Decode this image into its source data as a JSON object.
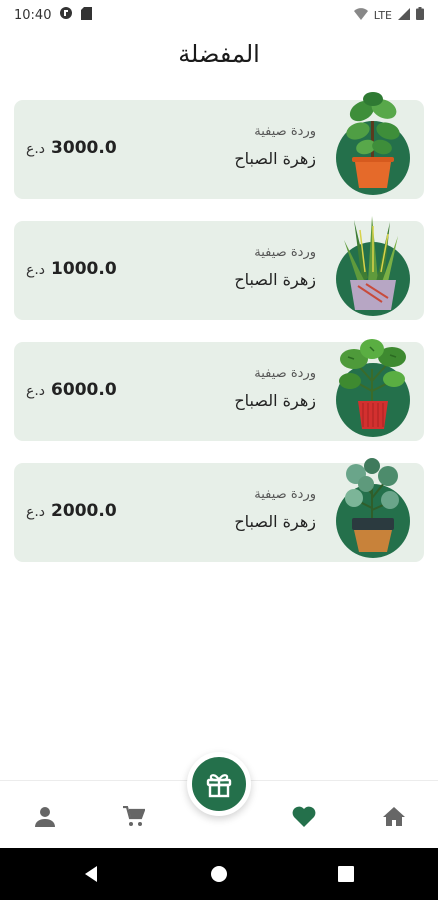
{
  "status_bar": {
    "time": "10:40",
    "network": "LTE"
  },
  "page_title": "المفضلة",
  "items": [
    {
      "subtitle": "وردة صيفية",
      "title": "زهرة الصباح",
      "price": "3000.0",
      "currency": "د.ع",
      "plant_icon": "fiddle-leaf-fig"
    },
    {
      "subtitle": "وردة صيفية",
      "title": "زهرة الصباح",
      "price": "1000.0",
      "currency": "د.ع",
      "plant_icon": "snake-plant"
    },
    {
      "subtitle": "وردة صيفية",
      "title": "زهرة الصباح",
      "price": "6000.0",
      "currency": "د.ع",
      "plant_icon": "monstera"
    },
    {
      "subtitle": "وردة صيفية",
      "title": "زهرة الصباح",
      "price": "2000.0",
      "currency": "د.ع",
      "plant_icon": "round-leaf-plant"
    }
  ],
  "bottom_nav": {
    "items": [
      "profile-icon",
      "cart-icon",
      "gift-icon",
      "favorites-icon",
      "home-icon"
    ],
    "active": "favorites-icon"
  },
  "colors": {
    "accent": "#24704b",
    "card_bg": "#e7efe8",
    "pot_orange": "#e56a2a",
    "pot_red": "#d3302f"
  }
}
